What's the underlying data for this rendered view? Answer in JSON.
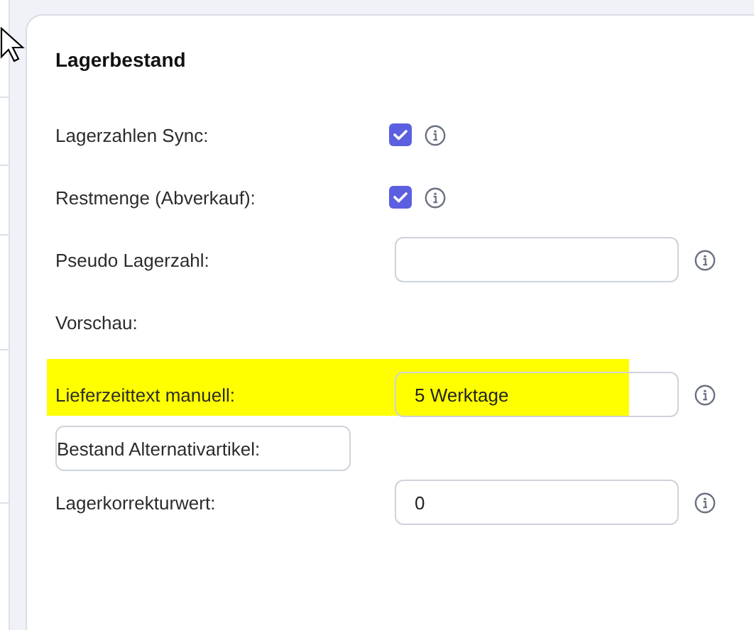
{
  "card": {
    "title": "Lagerbestand"
  },
  "rows": [
    {
      "kind": "checkbox",
      "label": "Lagerzahlen Sync:",
      "checked": true,
      "info": true
    },
    {
      "kind": "checkbox",
      "label": "Restmenge (Abverkauf):",
      "checked": true,
      "info": true
    },
    {
      "kind": "input",
      "label": "Pseudo Lagerzahl:",
      "info": true
    },
    {
      "kind": "text",
      "label": "Vorschau:"
    },
    {
      "kind": "input",
      "label": "Lieferzeittext manuell:",
      "value": "5 Werktage",
      "info": true,
      "highlighted": true
    },
    {
      "kind": "search",
      "label": "Bestand Alternativartikel:"
    },
    {
      "kind": "input",
      "label": "Lagerkorrekturwert:",
      "value": "0",
      "info": true
    }
  ]
}
